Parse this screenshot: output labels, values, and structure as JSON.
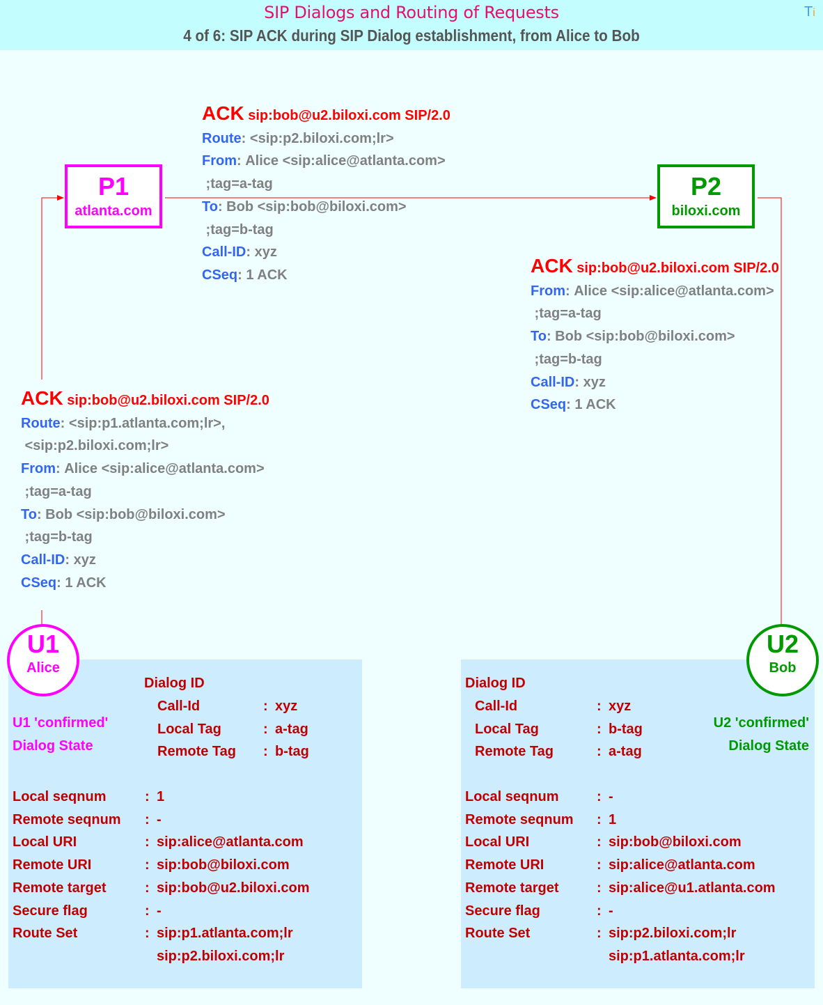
{
  "header": {
    "title": "SIP Dialogs and Routing of Requests",
    "subtitle": "4 of 6: SIP ACK during SIP Dialog establishment, from Alice to Bob",
    "logo_t": "T",
    "logo_i": "i"
  },
  "colors": {
    "header_bg": "#c4fdfe",
    "page_bg": "#effeff",
    "title": "#e5106a",
    "alice_side": "#ff00ff",
    "bob_side": "#009900",
    "request_line": "#ff0000",
    "header_name": "#3366ee",
    "header_value": "#808080",
    "state_text": "#c00000",
    "state_panel": "#cdecfe",
    "arrow": "#ff0000"
  },
  "nodes": {
    "p1": {
      "name": "P1",
      "domain": "atlanta.com"
    },
    "p2": {
      "name": "P2",
      "domain": "biloxi.com"
    },
    "u1": {
      "name": "U1",
      "user": "Alice"
    },
    "u2": {
      "name": "U2",
      "user": "Bob"
    }
  },
  "messages": {
    "u1_to_p1": {
      "method": "ACK",
      "request_uri": "sip:bob@u2.biloxi.com SIP/2.0",
      "headers": [
        {
          "name": "Route",
          "value": " <sip:p1.atlanta.com;lr>,"
        },
        {
          "name": "",
          "value": " <sip:p2.biloxi.com;lr>"
        },
        {
          "name": "From",
          "value": " Alice <sip:alice@atlanta.com>"
        },
        {
          "name": "",
          "value": " ;tag=a-tag"
        },
        {
          "name": "To",
          "value": " Bob <sip:bob@biloxi.com>"
        },
        {
          "name": "",
          "value": " ;tag=b-tag"
        },
        {
          "name": "Call-ID",
          "value": " xyz"
        },
        {
          "name": "CSeq",
          "value": " 1 ACK"
        }
      ]
    },
    "p1_to_p2": {
      "method": "ACK",
      "request_uri": "sip:bob@u2.biloxi.com SIP/2.0",
      "headers": [
        {
          "name": "Route",
          "value": " <sip:p2.biloxi.com;lr>"
        },
        {
          "name": "From",
          "value": " Alice <sip:alice@atlanta.com>"
        },
        {
          "name": "",
          "value": " ;tag=a-tag"
        },
        {
          "name": "To",
          "value": " Bob <sip:bob@biloxi.com>"
        },
        {
          "name": "",
          "value": " ;tag=b-tag"
        },
        {
          "name": "Call-ID",
          "value": " xyz"
        },
        {
          "name": "CSeq",
          "value": " 1 ACK"
        }
      ]
    },
    "p2_to_u2": {
      "method": "ACK",
      "request_uri": "sip:bob@u2.biloxi.com SIP/2.0",
      "headers": [
        {
          "name": "From",
          "value": " Alice <sip:alice@atlanta.com>"
        },
        {
          "name": "",
          "value": " ;tag=a-tag"
        },
        {
          "name": "To",
          "value": " Bob <sip:bob@biloxi.com>"
        },
        {
          "name": "",
          "value": " ;tag=b-tag"
        },
        {
          "name": "Call-ID",
          "value": " xyz"
        },
        {
          "name": "CSeq",
          "value": " 1 ACK"
        }
      ]
    }
  },
  "dialog_states": {
    "u1": {
      "state_line1": "U1 'confirmed'",
      "state_line2": "Dialog State",
      "dialog_id_label": "Dialog ID",
      "dialog_id": [
        {
          "label": "Call-Id",
          "value": "xyz"
        },
        {
          "label": "Local Tag",
          "value": "a-tag"
        },
        {
          "label": "Remote Tag",
          "value": "b-tag"
        }
      ],
      "fields": [
        {
          "label": "Local seqnum",
          "value": "1"
        },
        {
          "label": "Remote seqnum",
          "value": "-"
        },
        {
          "label": "Local URI",
          "value": "sip:alice@atlanta.com"
        },
        {
          "label": "Remote URI",
          "value": "sip:bob@biloxi.com"
        },
        {
          "label": "Remote target",
          "value": "sip:bob@u2.biloxi.com"
        },
        {
          "label": "Secure flag",
          "value": "-"
        },
        {
          "label": "Route Set",
          "value": "sip:p1.atlanta.com;lr"
        },
        {
          "label": "",
          "value": "sip:p2.biloxi.com;lr"
        }
      ]
    },
    "u2": {
      "state_line1": "U2 'confirmed'",
      "state_line2": "Dialog State",
      "dialog_id_label": "Dialog ID",
      "dialog_id": [
        {
          "label": "Call-Id",
          "value": "xyz"
        },
        {
          "label": "Local Tag",
          "value": "b-tag"
        },
        {
          "label": "Remote Tag",
          "value": "a-tag"
        }
      ],
      "fields": [
        {
          "label": "Local seqnum",
          "value": "-"
        },
        {
          "label": "Remote seqnum",
          "value": "1"
        },
        {
          "label": "Local URI",
          "value": "sip:bob@biloxi.com"
        },
        {
          "label": "Remote URI",
          "value": "sip:alice@atlanta.com"
        },
        {
          "label": "Remote target",
          "value": "sip:alice@u1.atlanta.com"
        },
        {
          "label": "Secure flag",
          "value": "-"
        },
        {
          "label": "Route Set",
          "value": "sip:p2.biloxi.com;lr"
        },
        {
          "label": "",
          "value": "sip:p1.atlanta.com;lr"
        }
      ]
    }
  },
  "separator": ":"
}
